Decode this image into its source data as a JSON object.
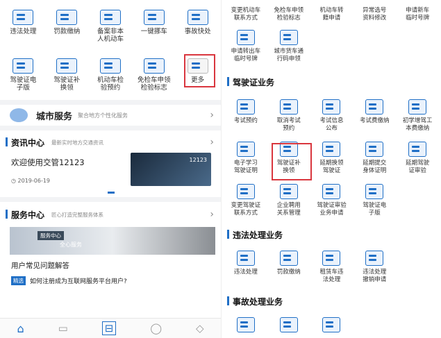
{
  "left": {
    "row1": [
      "违法处理",
      "罚款缴纳",
      "备案非本\n人机动车",
      "一键挪车",
      "事故快处"
    ],
    "row2": [
      "驾驶证电\n子版",
      "驾驶证补\n换领",
      "机动车检\n验预约",
      "免检车申领\n检验标志",
      "更多"
    ],
    "city_service": {
      "title": "城市服务",
      "subtitle": "聚合地方个性化服务"
    },
    "news": {
      "title": "资讯中心",
      "subtitle": "最新实时地方交通资讯",
      "headline": "欢迎使用交管12123",
      "date": "2019-06-19",
      "image_caption": "12123"
    },
    "service_center": {
      "title": "服务中心",
      "subtitle": "匠心打造完整服务体系",
      "banner_tag": "服务中心",
      "banner_text": "全心服务",
      "faq_title": "用户常见问题解答",
      "faq_badge": "精选",
      "faq_question": "如何注册成为互联网服务平台用户?"
    },
    "bottom_nav": [
      "home-icon",
      "monitor-icon",
      "scan-icon",
      "user-icon",
      "tag-icon"
    ]
  },
  "right": {
    "top_row1": [
      "变更机动车\n联系方式",
      "免检车申领\n检验标志",
      "机动车转\n籍申请",
      "异常选号\n资料修改",
      "申请新车\n临时号牌"
    ],
    "top_row2": [
      "申请转出车\n临时号牌",
      "城市货车通\n行码申领"
    ],
    "license_section": {
      "title": "驾驶证业务",
      "row1": [
        "考试预约",
        "取消考试\n预约",
        "考试信息\n公布",
        "考试费缴纳",
        "初学增驾工\n本费缴纳"
      ],
      "row2": [
        "电子学习\n驾驶证明",
        "驾驶证补\n换领",
        "延期换领\n驾驶证",
        "延期提交\n身体证明",
        "延期驾驶\n证审验"
      ],
      "row3": [
        "变更驾驶证\n联系方式",
        "企业聘用\n关系管理",
        "驾驶证审验\n业务申请",
        "驾驶证电\n子版"
      ]
    },
    "violation_section": {
      "title": "违法处理业务",
      "row1": [
        "违法处理",
        "罚款缴纳",
        "租赁车违\n法处理",
        "违法处理\n撤销申请"
      ]
    },
    "accident_section": {
      "title": "事故处理业务"
    }
  },
  "colors": {
    "accent": "#1f6fc6",
    "highlight": "#d9363e"
  }
}
